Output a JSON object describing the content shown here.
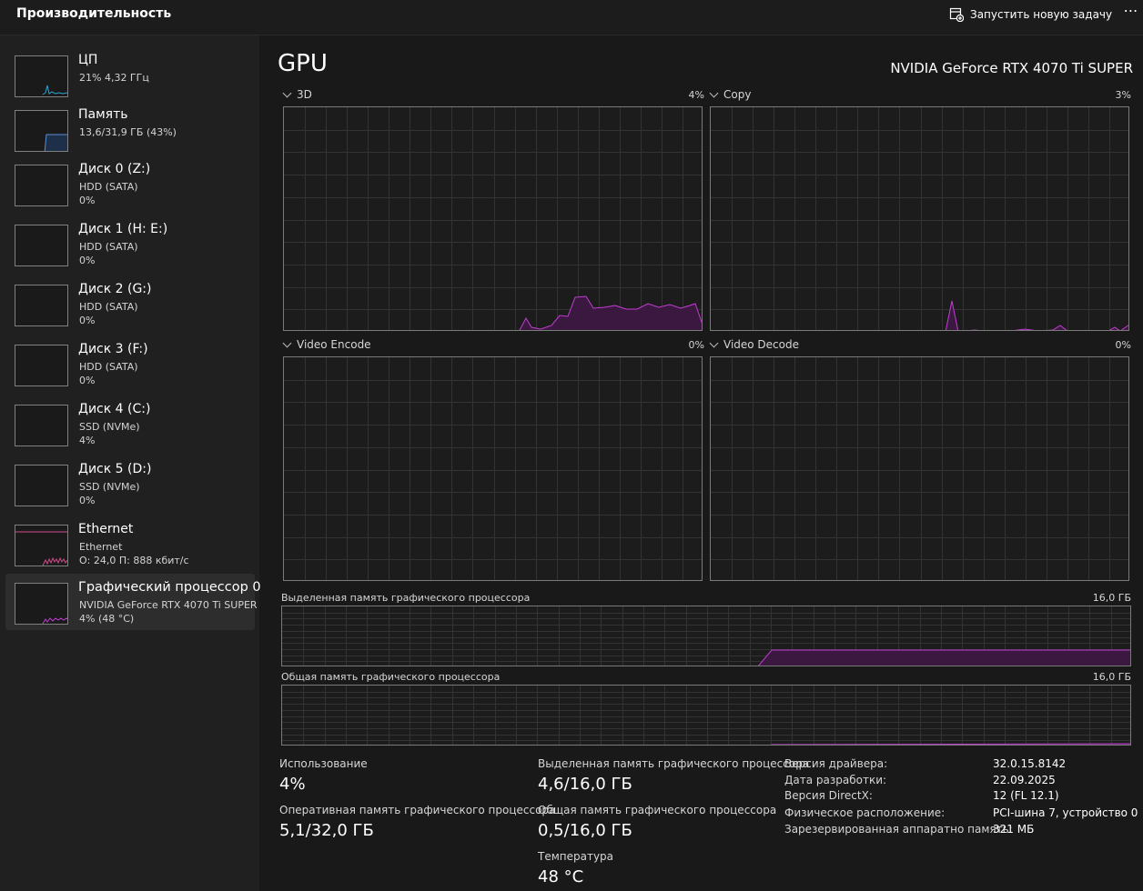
{
  "header": {
    "title": "Производительность",
    "run_task_label": "Запустить новую задачу",
    "more_label": "⋯"
  },
  "sidebar": {
    "items": [
      {
        "title": "ЦП",
        "subtitle": "21% 4,32 ГГц",
        "value": ""
      },
      {
        "title": "Память",
        "subtitle": "13,6/31,9 ГБ (43%)",
        "value": ""
      },
      {
        "title": "Диск 0 (Z:)",
        "subtitle": "HDD (SATA)",
        "value": "0%"
      },
      {
        "title": "Диск 1 (H: E:)",
        "subtitle": "HDD (SATA)",
        "value": "0%"
      },
      {
        "title": "Диск 2 (G:)",
        "subtitle": "HDD (SATA)",
        "value": "0%"
      },
      {
        "title": "Диск 3 (F:)",
        "subtitle": "HDD (SATA)",
        "value": "0%"
      },
      {
        "title": "Диск 4 (C:)",
        "subtitle": "SSD (NVMe)",
        "value": "4%"
      },
      {
        "title": "Диск 5 (D:)",
        "subtitle": "SSD (NVMe)",
        "value": "0%"
      },
      {
        "title": "Ethernet",
        "subtitle": "Ethernet",
        "value": "О: 24,0 П: 888 кбит/с"
      },
      {
        "title": "Графический процессор 0",
        "subtitle": "NVIDIA GeForce RTX 4070 Ti SUPER",
        "value": "4% (48 °C)"
      }
    ]
  },
  "main": {
    "title": "GPU",
    "device_name": "NVIDIA GeForce RTX 4070 Ti SUPER",
    "engines": [
      {
        "label": "3D",
        "percent": "4%"
      },
      {
        "label": "Copy",
        "percent": "3%"
      },
      {
        "label": "Video Encode",
        "percent": "0%"
      },
      {
        "label": "Video Decode",
        "percent": "0%"
      }
    ],
    "dedicated_memory": {
      "label": "Выделенная память графического процессора",
      "max": "16,0 ГБ"
    },
    "shared_memory": {
      "label": "Общая память графического процессора",
      "max": "16,0 ГБ"
    }
  },
  "stats": {
    "usage_label": "Использование",
    "usage_value": "4%",
    "gpu_ram_label": "Оперативная память графического процессора",
    "gpu_ram_value": "5,1/32,0 ГБ",
    "dedicated_label": "Выделенная память графического процессора",
    "dedicated_value": "4,6/16,0 ГБ",
    "shared_label": "Общая память графического процессора",
    "shared_value": "0,5/16,0 ГБ",
    "temp_label": "Температура",
    "temp_value": "48 °C"
  },
  "info": [
    {
      "key": "Версия драйвера:",
      "value": "32.0.15.8142"
    },
    {
      "key": "Дата разработки:",
      "value": "22.09.2025"
    },
    {
      "key": "Версия DirectX:",
      "value": "12 (FL 12.1)"
    },
    {
      "key": "Физическое расположение:",
      "value": "PCI-шина 7, устройство 0,..."
    },
    {
      "key": "Зарезервированная аппаратно память:",
      "value": "321 МБ"
    }
  ],
  "colors": {
    "gpu": "#c33dd3",
    "cpu": "#2aa7d6",
    "memory": "#5b8fd4",
    "ethernet": "#d04a8a"
  }
}
